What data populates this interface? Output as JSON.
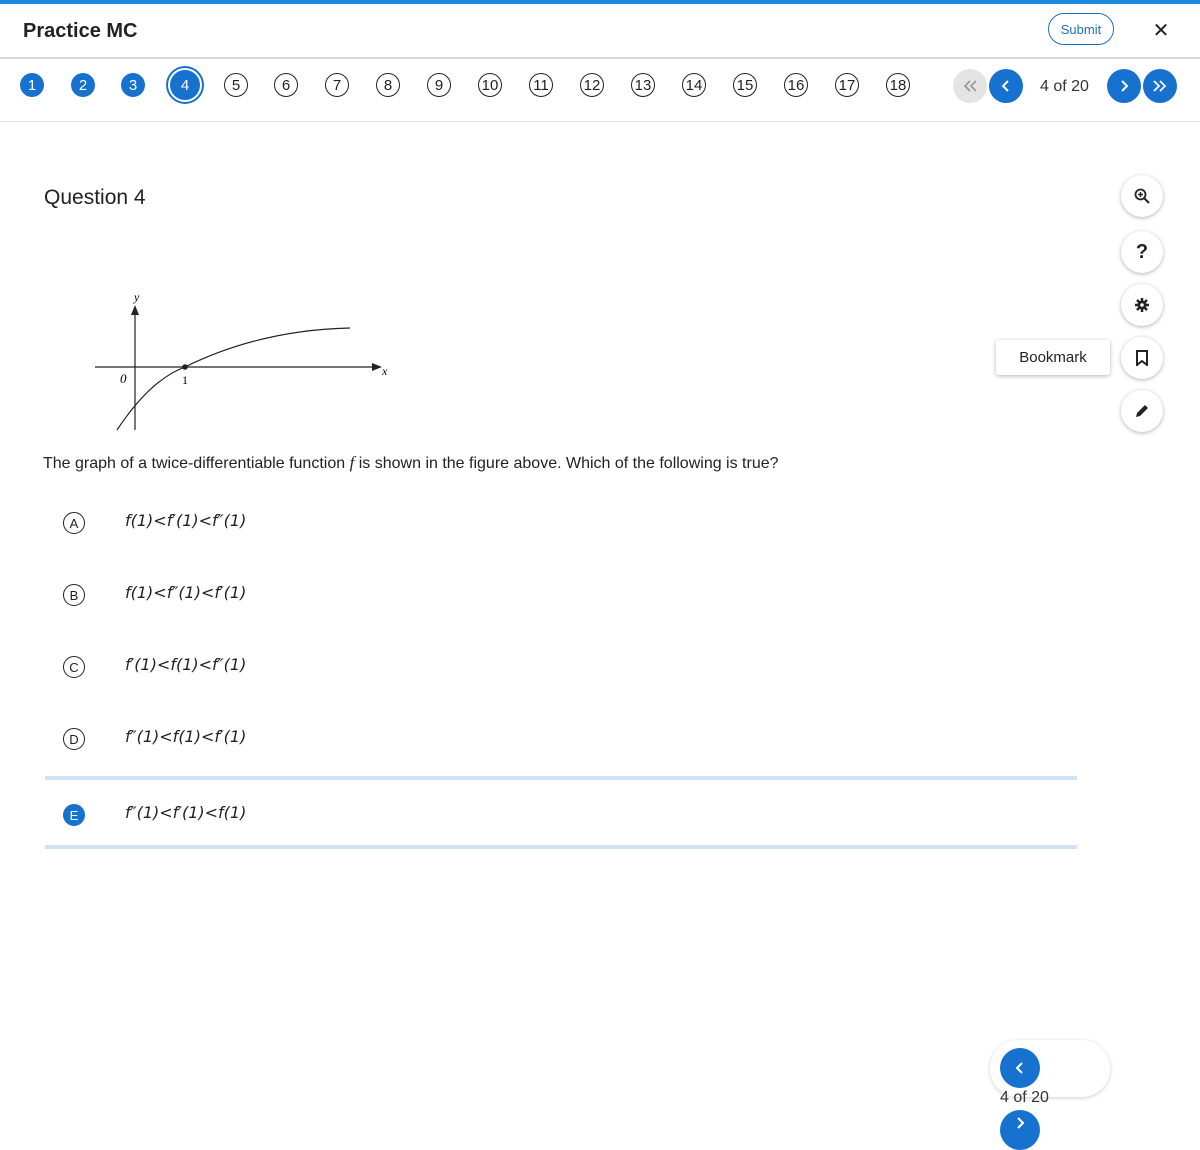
{
  "header": {
    "title": "Practice MC",
    "submit_label": "Submit",
    "close_icon": "✕"
  },
  "question_nav": {
    "numbers": [
      "1",
      "2",
      "3",
      "4",
      "5",
      "6",
      "7",
      "8",
      "9",
      "10",
      "11",
      "12",
      "13",
      "14",
      "15",
      "16",
      "17",
      "18"
    ],
    "current": "4",
    "counter": "4 of 20"
  },
  "question": {
    "title": "Question 4",
    "prompt_before": "The graph of a twice-differentiable function ",
    "prompt_var": "f",
    "prompt_after": " is shown in the figure above. Which of the following is true?",
    "graph_labels": {
      "y": "y",
      "x": "x",
      "origin": "0",
      "one": "1"
    },
    "choices": [
      {
        "letter": "A",
        "text": "f(1)<f′(1)<f″(1)"
      },
      {
        "letter": "B",
        "text": "f(1)<f″(1)<f′(1)"
      },
      {
        "letter": "C",
        "text": "f′(1)<f(1)<f″(1)"
      },
      {
        "letter": "D",
        "text": "f″(1)<f(1)<f′(1)"
      },
      {
        "letter": "E",
        "text": "f″(1)<f′(1)<f(1)"
      }
    ],
    "selected": "E"
  },
  "tools": {
    "bookmark_label": "Bookmark",
    "icons": [
      "zoom-in-icon",
      "help-icon",
      "settings-icon",
      "bookmark-icon",
      "pencil-icon"
    ],
    "help_glyph": "?"
  },
  "bottom_nav": {
    "counter": "4 of 20"
  },
  "colors": {
    "accent": "#1771cf",
    "selection_band": "#cfe3f5",
    "top_bar": "#1b8be0"
  }
}
